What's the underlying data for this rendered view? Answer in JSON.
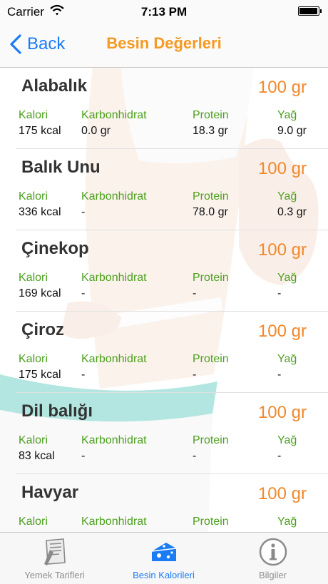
{
  "status": {
    "carrier": "Carrier",
    "time": "7:13 PM"
  },
  "nav": {
    "back_label": "Back",
    "title": "Besin Değerleri"
  },
  "columns": {
    "kalori": "Kalori",
    "karbonhidrat": "Karbonhidrat",
    "protein": "Protein",
    "yag": "Yağ"
  },
  "foods": [
    {
      "name": "Alabalık",
      "portion": "100 gr",
      "kalori": "175 kcal",
      "karbonhidrat": "0.0 gr",
      "protein": "18.3 gr",
      "yag": "9.0 gr"
    },
    {
      "name": "Balık Unu",
      "portion": "100 gr",
      "kalori": "336 kcal",
      "karbonhidrat": "-",
      "protein": "78.0 gr",
      "yag": "0.3 gr"
    },
    {
      "name": "Çinekop",
      "portion": "100 gr",
      "kalori": "169 kcal",
      "karbonhidrat": "-",
      "protein": "-",
      "yag": "-"
    },
    {
      "name": "Çiroz",
      "portion": "100 gr",
      "kalori": "175 kcal",
      "karbonhidrat": "-",
      "protein": "-",
      "yag": "-"
    },
    {
      "name": "Dil balığı",
      "portion": "100 gr",
      "kalori": "83 kcal",
      "karbonhidrat": "-",
      "protein": "-",
      "yag": "-"
    },
    {
      "name": "Havyar",
      "portion": "100 gr",
      "kalori": "",
      "karbonhidrat": "",
      "protein": "",
      "yag": ""
    }
  ],
  "tabs": [
    {
      "label": "Yemek Tarifleri",
      "icon": "recipe-book-icon"
    },
    {
      "label": "Besin Kalorileri",
      "icon": "cheese-icon",
      "active": true
    },
    {
      "label": "Bilgiler",
      "icon": "info-icon"
    }
  ],
  "colors": {
    "accent": "#1b7cf5",
    "title": "#f59a22",
    "portion": "#f0882b",
    "label": "#4ca01e"
  }
}
